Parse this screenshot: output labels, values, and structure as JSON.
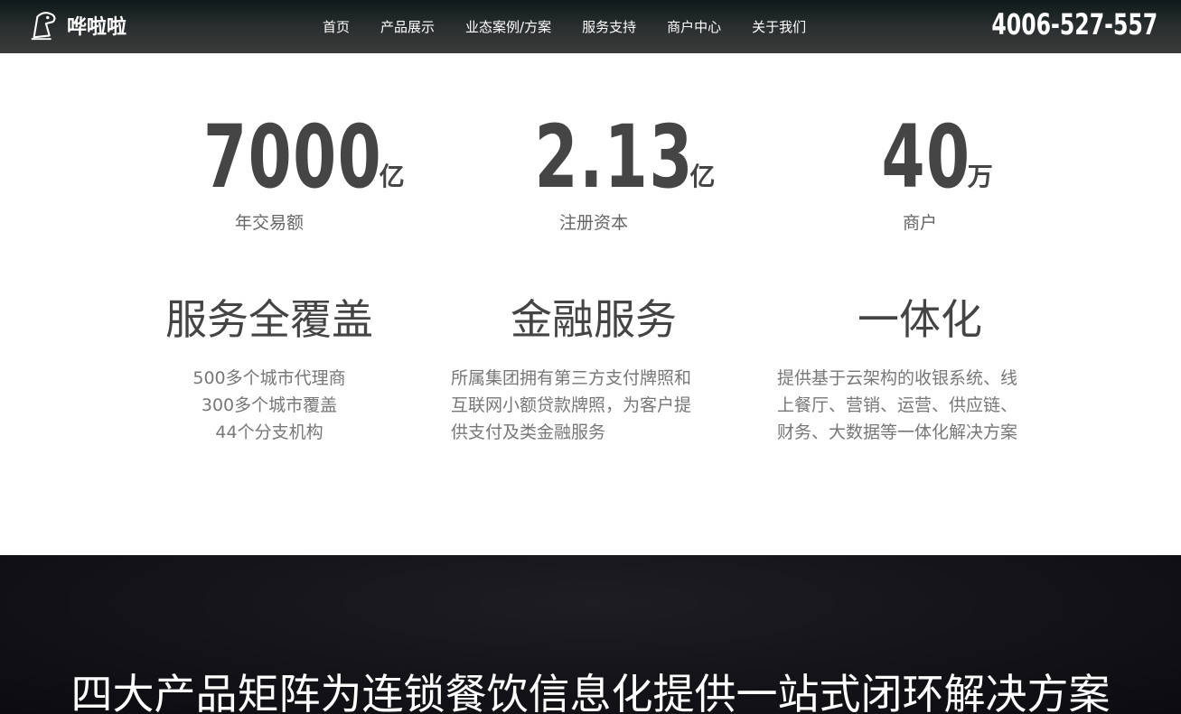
{
  "header": {
    "logo_text": "哗啦啦",
    "nav": [
      {
        "label": "首页"
      },
      {
        "label": "产品展示"
      },
      {
        "label": "业态案例/方案"
      },
      {
        "label": "服务支持"
      },
      {
        "label": "商户中心"
      },
      {
        "label": "关于我们"
      }
    ],
    "phone": "4006-527-557"
  },
  "stats": [
    {
      "value": "7000",
      "unit": "亿",
      "label": "年交易额"
    },
    {
      "value": "2.13",
      "unit": "亿",
      "label": "注册资本"
    },
    {
      "value": "40",
      "unit": "万",
      "label": "商户"
    }
  ],
  "features": [
    {
      "title": "服务全覆盖",
      "lines": [
        "500多个城市代理商",
        "300多个城市覆盖",
        "44个分支机构"
      ]
    },
    {
      "title": "金融服务",
      "lines": [
        "所属集团拥有第三方支付牌照和",
        "互联网小额贷款牌照，为客户提",
        "供支付及类金融服务"
      ]
    },
    {
      "title": "一体化",
      "lines": [
        "提供基于云架构的收银系统、线",
        "上餐厅、营销、运营、供应链、",
        "财务、大数据等一体化解决方案"
      ]
    }
  ],
  "banner": {
    "title": "四大产品矩阵为连锁餐饮信息化提供一站式闭环解决方案"
  },
  "colors": {
    "header_bg": "#2c3030",
    "text_dark": "#454545",
    "banner_bg": "#131318"
  }
}
